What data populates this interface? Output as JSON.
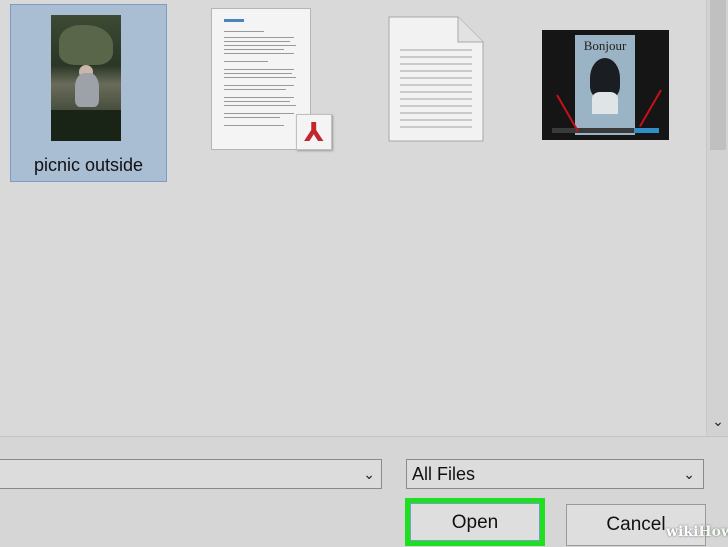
{
  "files": [
    {
      "name": "picnic outside",
      "type": "photo",
      "selected": true,
      "icon": "photo-thumbnail"
    },
    {
      "name": "",
      "type": "pdf",
      "icon": "pdf-document-thumbnail"
    },
    {
      "name": "",
      "type": "text",
      "icon": "text-document-thumbnail"
    },
    {
      "name": "",
      "type": "image",
      "icon": "bonjour-image-thumbnail",
      "thumb_title": "Bonjour"
    }
  ],
  "bottom": {
    "filename_value": "",
    "filetype_value": "All Files",
    "open_label": "Open",
    "cancel_label": "Cancel"
  },
  "watermark": {
    "prefix": "wiki",
    "suffix": "How"
  },
  "colors": {
    "selection": "#a9bdd3",
    "highlight": "#1ee01e",
    "pdf_red": "#c1272d"
  }
}
